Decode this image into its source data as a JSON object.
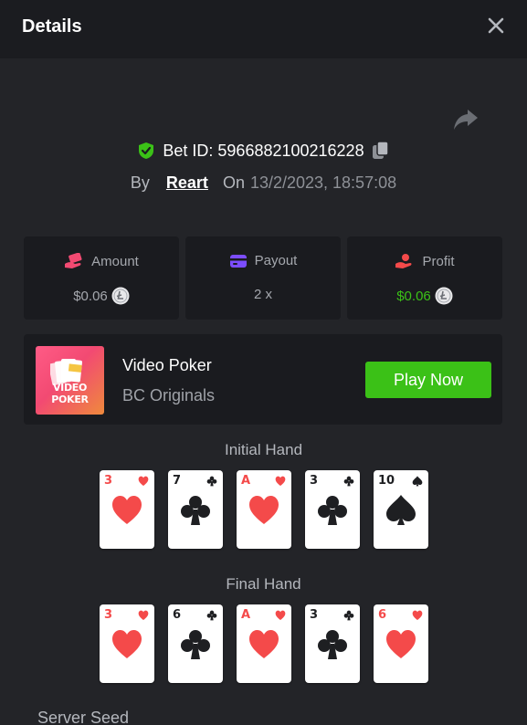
{
  "header": {
    "title": "Details"
  },
  "bet": {
    "id_label": "Bet ID: 5966882100216228",
    "by_label": "By",
    "user": "Reart",
    "on_label": "On",
    "date": "13/2/2023, 18:57:08"
  },
  "stats": {
    "amount": {
      "label": "Amount",
      "value": "$0.06"
    },
    "payout": {
      "label": "Payout",
      "value": "2 x"
    },
    "profit": {
      "label": "Profit",
      "value": "$0.06"
    }
  },
  "game": {
    "thumb_text": "VIDEO POKER",
    "name": "Video Poker",
    "provider": "BC Originals",
    "play_label": "Play Now"
  },
  "initial_hand": {
    "label": "Initial Hand",
    "cards": [
      {
        "rank": "3",
        "suit": "heart"
      },
      {
        "rank": "7",
        "suit": "club"
      },
      {
        "rank": "A",
        "suit": "heart"
      },
      {
        "rank": "3",
        "suit": "club"
      },
      {
        "rank": "10",
        "suit": "spade"
      }
    ]
  },
  "final_hand": {
    "label": "Final Hand",
    "cards": [
      {
        "rank": "3",
        "suit": "heart"
      },
      {
        "rank": "6",
        "suit": "club"
      },
      {
        "rank": "A",
        "suit": "heart"
      },
      {
        "rank": "3",
        "suit": "club"
      },
      {
        "rank": "6",
        "suit": "heart"
      }
    ]
  },
  "server_seed": {
    "label": "Server Seed"
  },
  "colors": {
    "accent_green": "#3bc117",
    "heart_red": "#f44a4a",
    "card_black": "#1e1f22",
    "background": "#232428",
    "panel": "#1a1b1f"
  },
  "icons": {
    "close": "close-icon",
    "share": "share-icon",
    "shield": "shield-check-icon",
    "copy": "copy-icon",
    "amount": "hand-money-icon",
    "payout": "wallet-card-icon",
    "profit": "profit-hand-icon",
    "coin": "litecoin-icon"
  }
}
